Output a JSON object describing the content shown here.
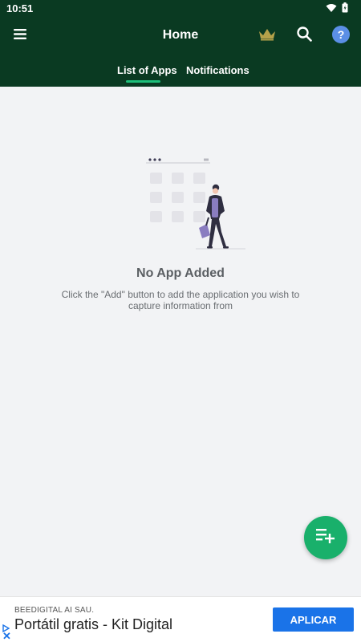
{
  "status_bar": {
    "time": "10:51"
  },
  "app_bar": {
    "title": "Home"
  },
  "tabs": [
    {
      "label": "List of Apps"
    },
    {
      "label": "Notifications"
    }
  ],
  "empty_state": {
    "title": "No App Added",
    "description": "Click the \"Add\" button to add the application you wish to capture information from"
  },
  "ad": {
    "advertiser": "BEEDIGITAL AI SAU.",
    "headline": "Portátil gratis - Kit Digital",
    "cta": "APLICAR"
  },
  "colors": {
    "header_bg": "#0a3a22",
    "tab_indicator": "#1dbf7a",
    "fab": "#19b06b",
    "crown": "#b5a24a",
    "help": "#5b8fe6",
    "ad_cta": "#1a73e8",
    "page_bg": "#f2f3f5"
  },
  "icons": [
    "wifi-icon",
    "battery-icon",
    "menu-icon",
    "crown-icon",
    "search-icon",
    "help-icon",
    "add-list-icon",
    "ad-choices-icon",
    "close-icon"
  ]
}
